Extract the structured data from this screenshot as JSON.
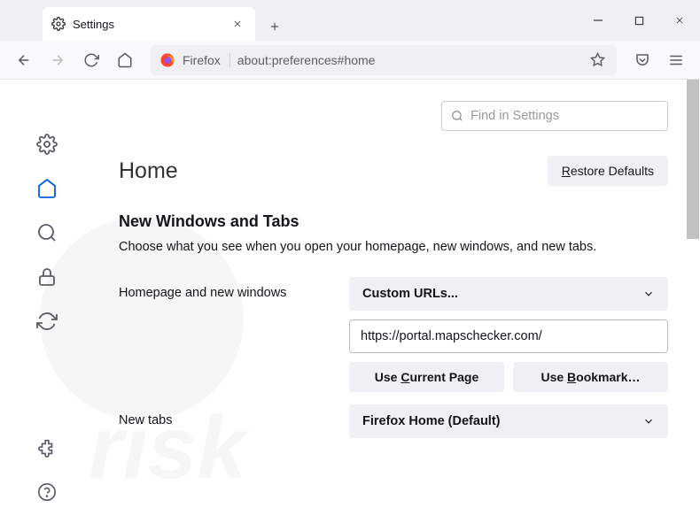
{
  "tab": {
    "title": "Settings"
  },
  "urlbar": {
    "identity": "Firefox",
    "url": "about:preferences#home"
  },
  "search": {
    "placeholder": "Find in Settings"
  },
  "page": {
    "title": "Home",
    "restore_defaults": "Restore Defaults",
    "section_title": "New Windows and Tabs",
    "section_desc": "Choose what you see when you open your homepage, new windows, and new tabs."
  },
  "homepage": {
    "label": "Homepage and new windows",
    "select_value": "Custom URLs...",
    "url_value": "https://portal.mapschecker.com/",
    "use_current": "Use Current Page",
    "use_bookmark": "Use Bookmark…"
  },
  "newtabs": {
    "label": "New tabs",
    "select_value": "Firefox Home (Default)"
  }
}
